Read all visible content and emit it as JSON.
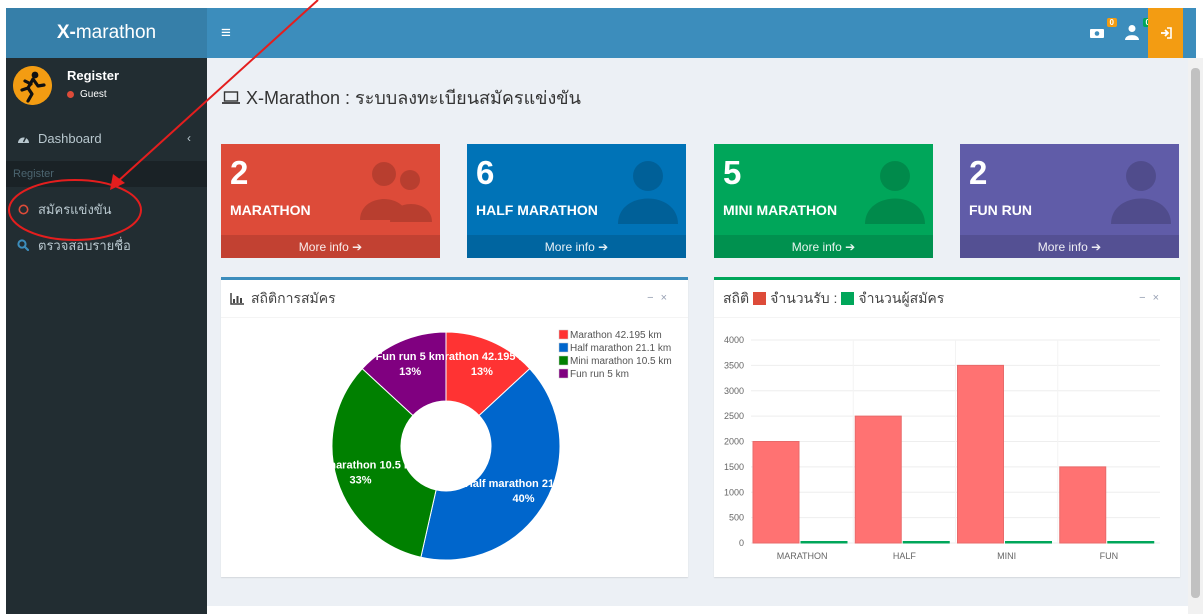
{
  "sidebar": {
    "brand_bold": "X-",
    "brand_rest": "marathon",
    "user": {
      "name": "Register",
      "status": "Guest"
    },
    "dashboard_label": "Dashboard",
    "section_header": "Register",
    "items": [
      {
        "label": "สมัครแข่งขัน",
        "icon": "circle-outline-icon"
      },
      {
        "label": "ตรวจสอบรายชื่อ",
        "icon": "search-icon"
      }
    ]
  },
  "topbar": {
    "notifications": [
      {
        "icon": "money-icon",
        "count": "0",
        "color": "#f39c12"
      },
      {
        "icon": "user-icon",
        "count": "0",
        "color": "#00a65a"
      }
    ]
  },
  "page": {
    "title": "X-Marathon : ระบบลงทะเบียนสมัครแข่งขัน"
  },
  "stat_boxes": [
    {
      "count": "2",
      "label": "MARATHON",
      "footer": "More info",
      "color": "#dd4b39",
      "icon": "users-icon"
    },
    {
      "count": "6",
      "label": "HALF MARATHON",
      "footer": "More info",
      "color": "#0073b7",
      "icon": "user-icon"
    },
    {
      "count": "5",
      "label": "MINI MARATHON",
      "footer": "More info",
      "color": "#00a65a",
      "icon": "user-icon"
    },
    {
      "count": "2",
      "label": "FUN RUN",
      "footer": "More info",
      "color": "#605ca8",
      "icon": "user-icon"
    }
  ],
  "pie_box": {
    "title": "สถิติการสมัคร",
    "border_color": "#3c8dbc"
  },
  "bar_box": {
    "title_prefix": "สถิติ",
    "legend1": "จำนวนรับ :",
    "legend2": "จำนวนผู้สมัคร",
    "border_color": "#00a65a"
  },
  "chart_data": [
    {
      "type": "pie",
      "categories": [
        "Marathon 42.195 km",
        "Half marathon 21.1 km",
        "Mini marathon 10.5 km",
        "Fun run 5 km"
      ],
      "values": [
        13,
        40,
        33,
        13
      ],
      "labels": [
        "Marathon 42.195 km",
        "Half marathon 21.1 km",
        "Mini marathon 10.5 km",
        "Fun run 5 km"
      ],
      "percent_labels": [
        "13%",
        "40%",
        "33%",
        "13%"
      ],
      "colors": [
        "#ff3333",
        "#0066cc",
        "#008000",
        "#800080"
      ],
      "legend_position": "top-right"
    },
    {
      "type": "bar",
      "categories": [
        "MARATHON",
        "HALF",
        "MINI",
        "FUN"
      ],
      "series": [
        {
          "name": "จำนวนรับ",
          "values": [
            2000,
            2500,
            3500,
            1500
          ],
          "color": "#ff7272"
        },
        {
          "name": "จำนวนผู้สมัคร",
          "values": [
            2,
            6,
            5,
            2
          ],
          "color": "#00a65a"
        }
      ],
      "ylim": [
        0,
        4000
      ],
      "yticks": [
        0,
        500,
        1000,
        1500,
        2000,
        2500,
        3000,
        3500,
        4000
      ],
      "grid": true
    }
  ]
}
